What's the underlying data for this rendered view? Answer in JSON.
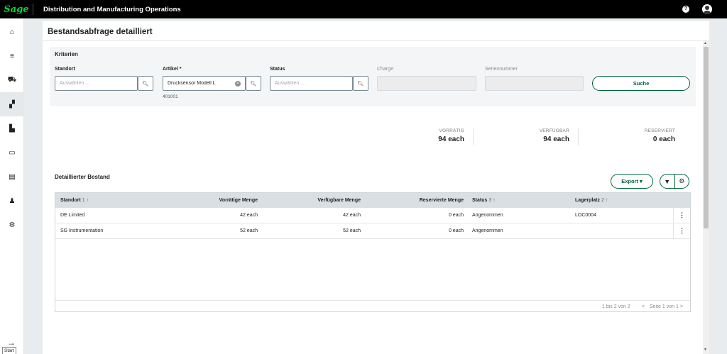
{
  "header": {
    "logo_text": "Sage",
    "app_title": "Distribution and Manufacturing Operations",
    "help_label": "?"
  },
  "sidebar": {
    "items": [
      {
        "icon": "home-icon",
        "glyph": "⌂"
      },
      {
        "icon": "menu-icon",
        "glyph": "≡"
      },
      {
        "icon": "cart-icon",
        "glyph": "⛟"
      },
      {
        "icon": "inventory-icon",
        "glyph": "▞"
      },
      {
        "icon": "factory-icon",
        "glyph": "▙"
      },
      {
        "icon": "card-icon",
        "glyph": "▭"
      },
      {
        "icon": "contact-card-icon",
        "glyph": "▤"
      },
      {
        "icon": "people-icon",
        "glyph": "♟"
      },
      {
        "icon": "settings-icon",
        "glyph": "⚙"
      }
    ],
    "start_arrow": "→",
    "start_tooltip": "Start"
  },
  "page": {
    "title": "Bestandsabfrage detailliert"
  },
  "criteria": {
    "title": "Kriterien",
    "standort": {
      "label": "Standort",
      "placeholder": "Auswählen ...",
      "value": ""
    },
    "artikel": {
      "label": "Artikel *",
      "value": "Drucksensor Modell L",
      "sub_value": "401001"
    },
    "status": {
      "label": "Status",
      "placeholder": "Auswählen ...",
      "value": ""
    },
    "charge": {
      "label": "Charge"
    },
    "seriennummer": {
      "label": "Seriennummer"
    },
    "search_label": "Suche"
  },
  "summary": {
    "vorraetig": {
      "label": "VORRÄTIG",
      "value": "94 each"
    },
    "verfuegbar": {
      "label": "VERFÜGBAR",
      "value": "94 each"
    },
    "reserviert": {
      "label": "RESERVIERT",
      "value": "0 each"
    }
  },
  "detail": {
    "title": "Detaillierter Bestand",
    "export_label": "Export",
    "export_caret": "▾",
    "columns": {
      "standort": {
        "label": "Standort",
        "sort": "1",
        "arrow": "↑"
      },
      "vorraetige_menge": {
        "label": "Vorrätige Menge"
      },
      "verfuegbare_menge": {
        "label": "Verfügbare Menge"
      },
      "reservierte_menge": {
        "label": "Reservierte Menge"
      },
      "status": {
        "label": "Status",
        "sort": "3",
        "arrow": "↑"
      },
      "lagerplatz": {
        "label": "Lagerplatz",
        "sort": "2",
        "arrow": "↑"
      }
    },
    "rows": [
      {
        "standort": "DE Limited",
        "vorraetig": "42 each",
        "verfuegbar": "42 each",
        "reserviert": "0 each",
        "status": "Angenommen",
        "lagerplatz": "LOC0004",
        "menu": "⋮"
      },
      {
        "standort": "SG Instrumentation",
        "vorraetig": "52 each",
        "verfuegbar": "52 each",
        "reserviert": "0 each",
        "status": "Angenommen",
        "lagerplatz": "",
        "menu": "⋮"
      }
    ],
    "footer": {
      "range": "1 bis 2 von 2",
      "prev": "<",
      "page": "Seite 1 von 1",
      "next": ">"
    }
  },
  "colors": {
    "brand_green": "#00d639",
    "accent_green": "#006738",
    "topbar": "#000000"
  }
}
